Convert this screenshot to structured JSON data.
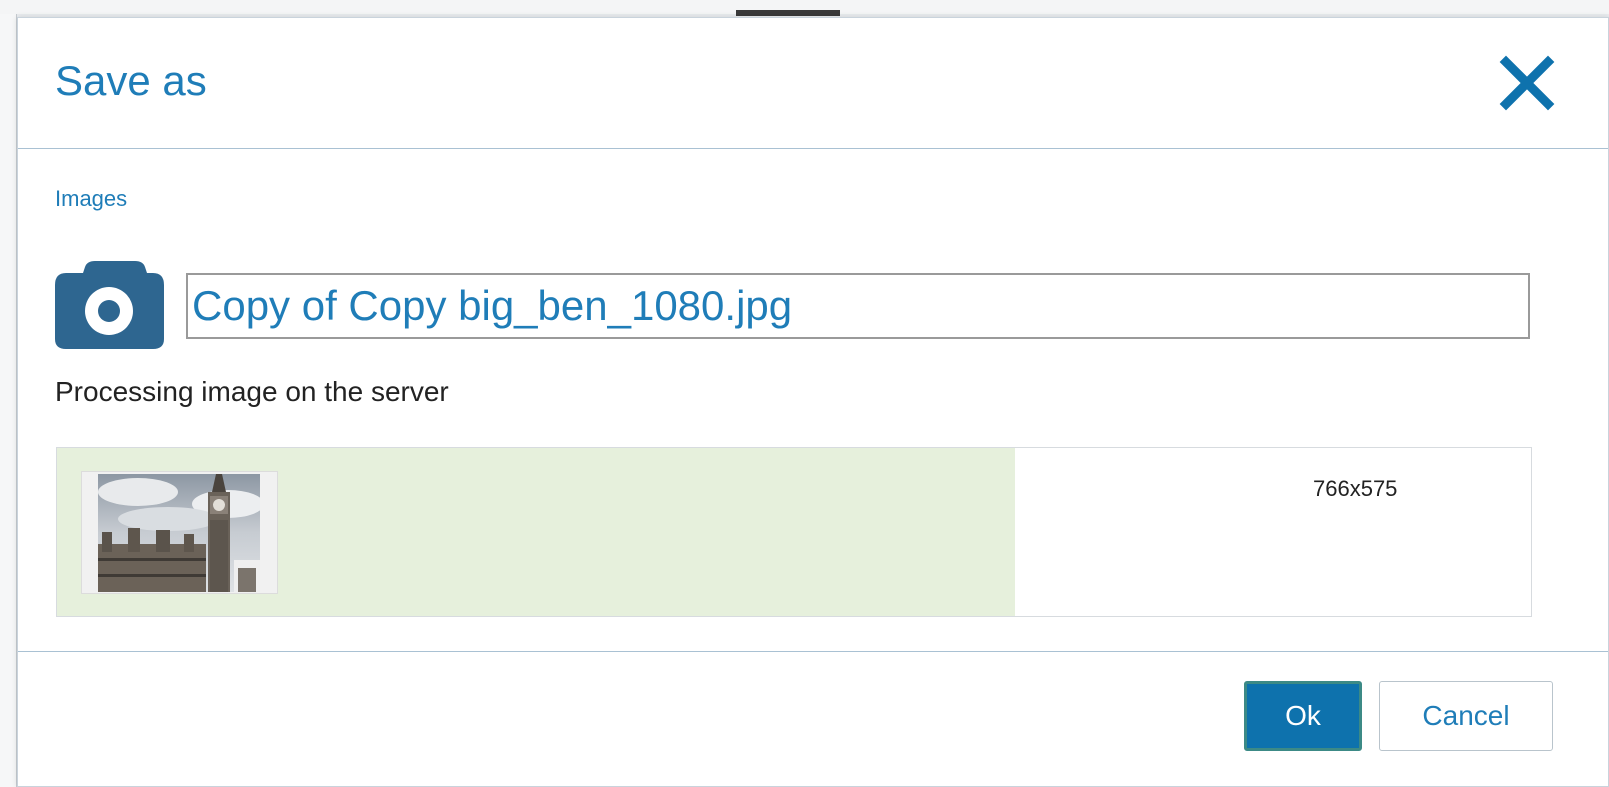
{
  "dialog": {
    "title": "Save as",
    "close_icon": "close-icon",
    "section_label": "Images",
    "file_icon": "camera-icon",
    "filename_value": "Copy of Copy big_ben_1080.jpg",
    "status_text": "Processing image on the server",
    "image": {
      "dimensions": "766x575",
      "progress_fraction": 0.65
    },
    "ok_label": "Ok",
    "cancel_label": "Cancel"
  },
  "colors": {
    "accent": "#1f7db8",
    "primary_button": "#0e72ad",
    "camera_icon": "#2e6690",
    "progress": "#e6f0dc"
  }
}
